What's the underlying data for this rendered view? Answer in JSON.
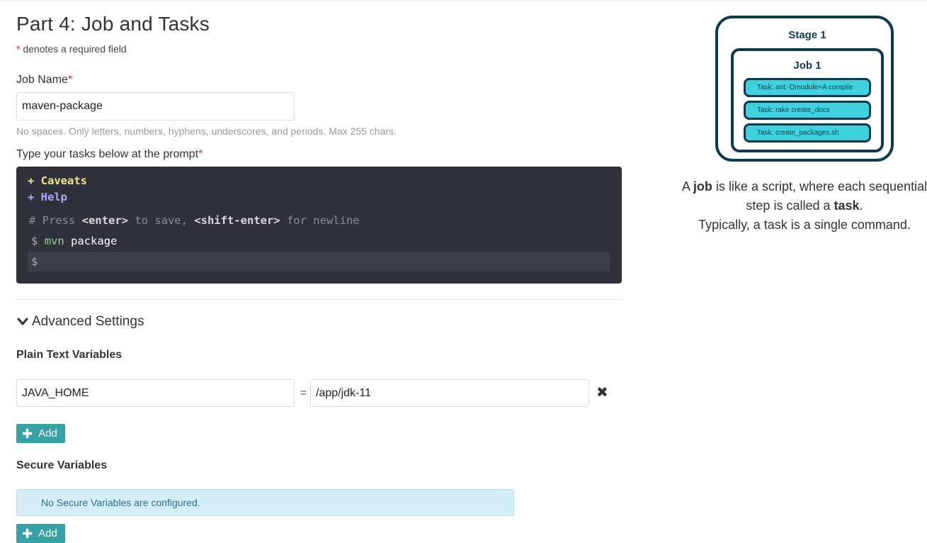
{
  "page": {
    "title": "Part 4: Job and Tasks",
    "required_star": "*",
    "required_note": "denotes a required field"
  },
  "job_name": {
    "label": "Job Name",
    "value": "maven-package",
    "help": "No spaces. Only letters, numbers, hyphens, underscores, and periods. Max 255 chars."
  },
  "tasks": {
    "label": "Type your tasks below at the prompt",
    "caveats": "+ Caveats",
    "help": "+ Help",
    "comment_prefix": "# Press ",
    "key_enter": "<enter>",
    "comment_mid": " to save, ",
    "key_shift_enter": "<shift-enter>",
    "comment_suffix": " for newline",
    "prompt_symbol": "$",
    "entered_command": "mvn",
    "entered_args": "package",
    "new_prompt": "$"
  },
  "advanced": {
    "toggle_label": "Advanced Settings",
    "plain_title": "Plain Text Variables",
    "plain_var": {
      "name": "JAVA_HOME",
      "equals": "=",
      "value": "/app/jdk-11",
      "remove": "✖"
    },
    "add_label": "Add",
    "secure_title": "Secure Variables",
    "secure_empty": "No Secure Variables are configured.",
    "secure_add_label": "Add"
  },
  "explanation": {
    "a": "A",
    "job": "job",
    "mid": "is like a script, where each sequential step is called a",
    "task": "task",
    "end": ".",
    "line2": "Typically, a task is a single command."
  },
  "diagram": {
    "stage": "Stage 1",
    "job": "Job 1",
    "tasks": [
      "Task: ant -Dmodule=A compile",
      "Task: rake create_docs",
      "Task: create_packages.sh"
    ]
  },
  "colors": {
    "accent": "#35a1a5",
    "terminal_bg": "#30313b",
    "diagram_dark": "#0e3b50",
    "task_fill": "#3fd1dc"
  }
}
